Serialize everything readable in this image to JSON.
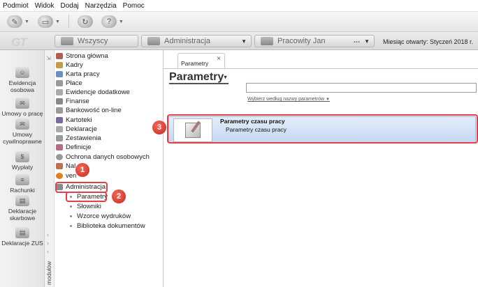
{
  "menu": [
    "Podmiot",
    "Widok",
    "Dodaj",
    "Narzędzia",
    "Pomoc"
  ],
  "logo": "GT",
  "context": {
    "tab1": "Wszyscy",
    "tab2": "Administracja",
    "tab3": "Pracowity Jan",
    "tab3_dots": "...",
    "month": "Miesiąc otwarty: Styczeń 2018 r."
  },
  "leftbar": [
    {
      "label": "Ewidencja osobowa"
    },
    {
      "label": "Umowy o pracę"
    },
    {
      "label": "Umowy cywilnoprawne"
    },
    {
      "label": "Wypłaty"
    },
    {
      "label": "Rachunki"
    },
    {
      "label": "Deklaracje skarbowe"
    },
    {
      "label": "Deklaracje ZUS"
    }
  ],
  "modules": {
    "strip_label": "modułów",
    "items": [
      "Strona główna",
      "Kadry",
      "Karta pracy",
      "Płace",
      "Ewidencje dodatkowe",
      "Finanse",
      "Bankowość on-line",
      "Kartoteki",
      "Deklaracje",
      "Zestawienia",
      "Definicje",
      "Ochrona danych osobowych",
      "Nal",
      "ven",
      "Administracja"
    ],
    "subitems": [
      "Parametry",
      "Słowniki",
      "Wzorce wydruków",
      "Biblioteka dokumentów"
    ]
  },
  "main": {
    "tab_label": "Parametry",
    "tab_close": "×",
    "title": "Parametry",
    "search_value": "",
    "search_hint": "Wybierz według nazwy parametrów",
    "result": {
      "title": "Parametry czasu pracy",
      "subtitle": "Parametry czasu pracy"
    }
  },
  "annotations": [
    "1",
    "2",
    "3"
  ],
  "colors": {
    "highlight": "#e0404a",
    "selection": "#c4d8f1"
  }
}
